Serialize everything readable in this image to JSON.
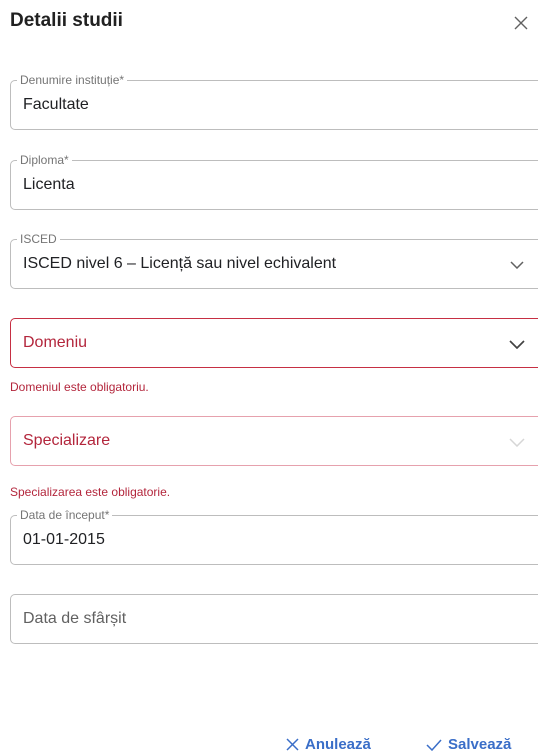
{
  "header": {
    "title": "Detalii studii",
    "close_icon": "close-icon"
  },
  "fields": {
    "institution": {
      "label": "Denumire instituție*",
      "value": "Facultate"
    },
    "diploma": {
      "label": "Diploma*",
      "value": "Licenta"
    },
    "isced": {
      "label": "ISCED",
      "value": "ISCED nivel 6 – Licență sau nivel echivalent"
    },
    "domain": {
      "placeholder": "Domeniu",
      "error": "Domeniul este obligatoriu."
    },
    "specialization": {
      "placeholder": "Specializare",
      "error": "Specializarea este obligatorie."
    },
    "start_date": {
      "label": "Data de început*",
      "value": "01-01-2015"
    },
    "end_date": {
      "placeholder": "Data de sfârșit"
    }
  },
  "actions": {
    "cancel_label": "Anulează",
    "save_label": "Salvează"
  },
  "colors": {
    "error": "#b3263c",
    "accent": "#3a6ec8",
    "border": "#bdbdbd"
  }
}
